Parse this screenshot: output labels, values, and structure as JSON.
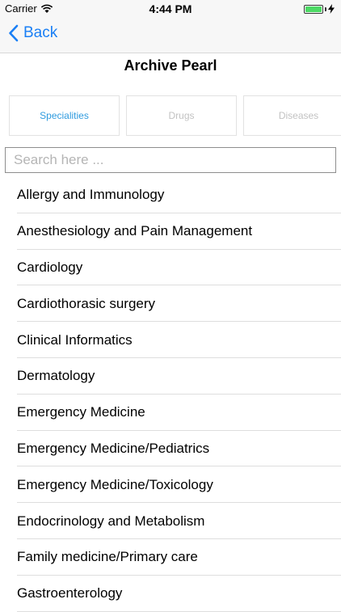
{
  "status_bar": {
    "carrier": "Carrier",
    "time": "4:44 PM",
    "battery_color": "#4cd964"
  },
  "nav": {
    "back_label": "Back"
  },
  "page": {
    "title": "Archive Pearl"
  },
  "tabs": [
    {
      "label": "Specialities",
      "active": true
    },
    {
      "label": "Drugs",
      "active": false
    },
    {
      "label": "Diseases",
      "active": false
    }
  ],
  "search": {
    "placeholder": "Search here ...",
    "value": ""
  },
  "items": [
    "Allergy and Immunology",
    "Anesthesiology and Pain Management",
    "Cardiology",
    "Cardiothorasic surgery",
    "Clinical Informatics",
    "Dermatology",
    "Emergency Medicine",
    "Emergency Medicine/Pediatrics",
    "Emergency Medicine/Toxicology",
    "Endocrinology and Metabolism",
    "Family medicine/Primary care",
    "Gastroenterology"
  ],
  "colors": {
    "accent": "#1a7ff5",
    "active_tab": "#2f9bdf",
    "inactive_tab": "#c2c2c2"
  }
}
